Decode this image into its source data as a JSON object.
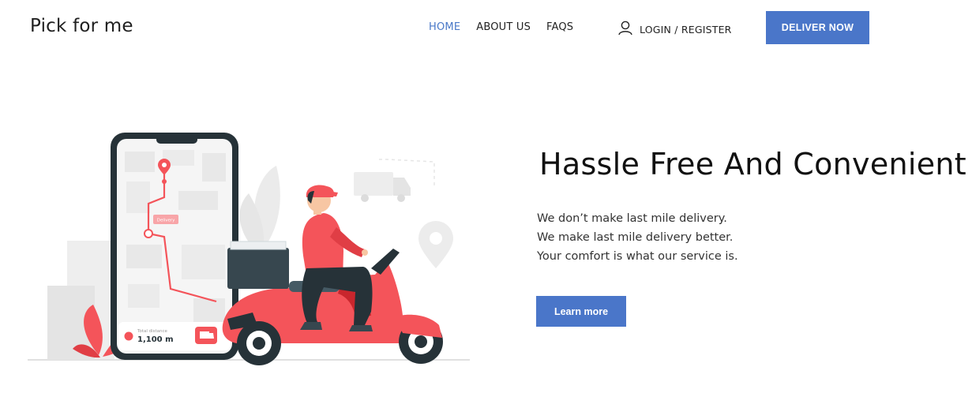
{
  "brand": {
    "name": "Pick for me"
  },
  "nav": {
    "items": [
      {
        "label": "HOME",
        "active": true
      },
      {
        "label": "ABOUT US",
        "active": false
      },
      {
        "label": "FAQS",
        "active": false
      }
    ],
    "login_label": "LOGIN / REGISTER",
    "cta_label": "DELIVER NOW"
  },
  "hero": {
    "headline": "Hassle Free And Convenient",
    "lines": [
      "We don’t make last mile delivery.",
      "We make last mile delivery better.",
      "Your comfort is what our service is."
    ],
    "button_label": "Learn more",
    "illustration": {
      "distance_label": "Total distance",
      "distance_value": "1,100 m",
      "map_tag": "Delivery"
    }
  },
  "colors": {
    "accent": "#4a76c9",
    "nav_active": "#4a79c8",
    "illustration_red": "#f4545a",
    "illustration_dark": "#263238"
  }
}
